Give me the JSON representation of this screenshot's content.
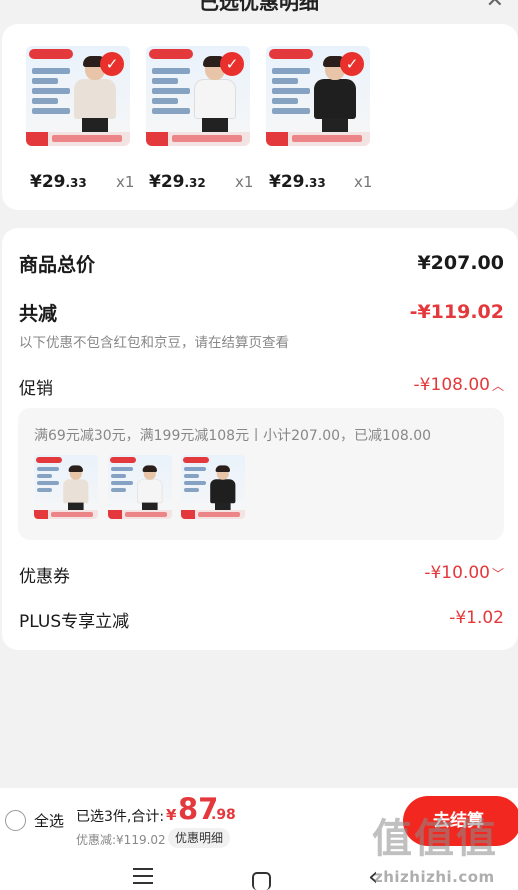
{
  "header": {
    "title": "已选优惠明细"
  },
  "products": [
    {
      "price_main": "¥29",
      "price_dec": ".33",
      "qty": "x1",
      "shirt_color": "#e9e1d8"
    },
    {
      "price_main": "¥29",
      "price_dec": ".32",
      "qty": "x1",
      "shirt_color": "#f5f5f5"
    },
    {
      "price_main": "¥29",
      "price_dec": ".33",
      "qty": "x1",
      "shirt_color": "#1f1f1f"
    }
  ],
  "summary": {
    "total_label": "商品总价",
    "total_value": "¥207.00",
    "reduce_label": "共减",
    "reduce_value": "-¥119.02",
    "hint": "以下优惠不包含红包和京豆，请在结算页查看",
    "promo_label": "促销",
    "promo_value": "-¥108.00",
    "promo_detail": "满69元减30元，满199元减108元丨小计207.00，已减108.00",
    "coupon_label": "优惠券",
    "coupon_value": "-¥10.00",
    "plus_label": "PLUS专享立减",
    "plus_value": "-¥1.02"
  },
  "bottom_bar": {
    "select_all": "全选",
    "selected_summary": "已选3件,合计:",
    "pay_symbol": "¥",
    "pay_int": "87",
    "pay_dec": ".98",
    "discount": "优惠减:¥119.02",
    "detail_button": "优惠明细",
    "checkout": "去结算"
  },
  "watermark": {
    "logo": "值值值",
    "url": "zhizhizhi.com"
  },
  "colors": {
    "accent": "#e4393c",
    "checkout": "#f2271f"
  }
}
